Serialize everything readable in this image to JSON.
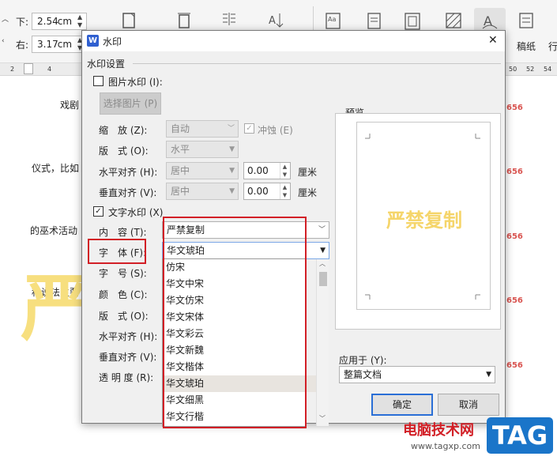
{
  "toolbar": {
    "margin_bottom_label": "下:",
    "margin_bottom_value": "2.54",
    "margin_right_label": "右:",
    "margin_right_value": "3.17",
    "unit": "cm",
    "manuscript_label": "稿纸",
    "line_label": "行"
  },
  "ruler": {
    "left_ticks": [
      "2",
      "2",
      "4"
    ],
    "right_ticks": [
      "50",
      "52",
      "54"
    ]
  },
  "document": {
    "line1": "戏剧",
    "line2": "仪式，比如",
    "line3": "的巫术活动",
    "line4": "种说法主要",
    "watermark_char": "严",
    "page_numbers": [
      "656",
      "656",
      "656",
      "656",
      "656"
    ]
  },
  "dialog": {
    "title": "水印",
    "logo_letter": "W",
    "close_glyph": "✕",
    "section_title": "水印设置",
    "image_watermark": {
      "label": "图片水印 (I):",
      "checked": false,
      "select_button": "选择图片 (P)",
      "scale_label": "缩　放 (Z):",
      "scale_value": "自动",
      "washout_label": "冲蚀 (E)",
      "layout_label": "版　式 (O):",
      "layout_value": "水平",
      "halign_label": "水平对齐 (H):",
      "halign_value": "居中",
      "halign_offset": "0.00",
      "valign_label": "垂直对齐 (V):",
      "valign_value": "居中",
      "valign_offset": "0.00",
      "offset_unit": "厘米"
    },
    "text_watermark": {
      "label": "文字水印 (X)",
      "checked": true,
      "content_label": "内　容 (T):",
      "content_value": "严禁复制",
      "font_label": "字　体 (F):",
      "font_value": "华文琥珀",
      "size_label": "字　号 (S):",
      "color_label": "颜　色 (C):",
      "layout_label": "版　式 (O):",
      "halign_label": "水平对齐 (H):",
      "valign_label": "垂直对齐 (V):",
      "opacity_label": "透 明 度 (R):"
    },
    "preview": {
      "label": "预览",
      "watermark_text": "严禁复制"
    },
    "apply_to": {
      "label": "应用于 (Y):",
      "value": "整篇文档"
    },
    "ok_button": "确定",
    "cancel_button": "取消",
    "font_options": [
      "仿宋",
      "华文中宋",
      "华文仿宋",
      "华文宋体",
      "华文彩云",
      "华文新魏",
      "华文楷体",
      "华文琥珀",
      "华文细黑",
      "华文行楷"
    ],
    "selected_font_index": 7
  },
  "branding": {
    "site_name": "电脑技术网",
    "site_url": "www.tagxp.com",
    "logo_text": "TAG"
  },
  "colors": {
    "accent": "#2a6fd6",
    "highlight_box": "#d21f26",
    "watermark_yellow": "#f5d56a",
    "page_number_red": "#d9534f",
    "logo_blue": "#1a75c9"
  }
}
